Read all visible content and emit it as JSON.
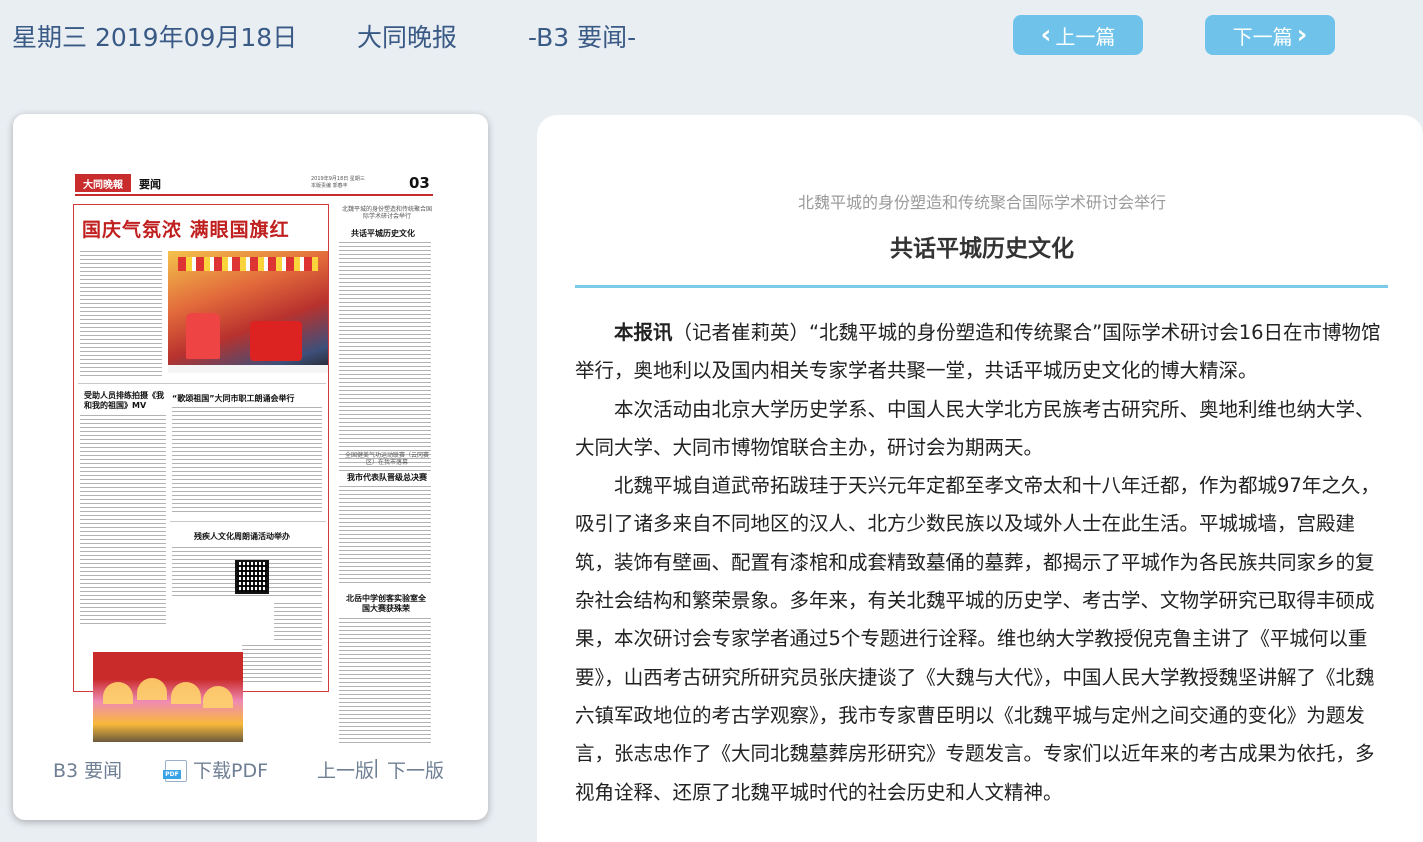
{
  "header": {
    "date": "星期三 2019年09月18日",
    "paper_name": "大同晚报",
    "section": "-B3 要闻-",
    "prev_label": "上一篇",
    "next_label": "下一篇"
  },
  "page_thumbnail": {
    "logo": "大同晚報",
    "section": "要闻",
    "date_line": "2019年9月18日 星期三",
    "editor_line": "本版责编 郭春丰",
    "page_number": "03",
    "headline": "国庆气氛浓 满眼国旗红",
    "stories": [
      "受助人员排练拍摄《我和我的祖国》MV",
      "“歌颂祖国”大同市职工朗诵会举行",
      "残疾人文化周朗诵活动举办",
      "北魏平城的身份塑造和传统聚合国际学术研讨会举行",
      "共话平城历史文化",
      "全国健美气功运动联赛（云冈赛区）在我市落幕",
      "我市代表队晋级总决赛",
      "北岳中学创客实验室全国大赛获殊荣"
    ]
  },
  "card_footer": {
    "section": "B3 要闻",
    "download_pdf": "下载PDF",
    "prev_edition": "上一版",
    "separator": "|",
    "next_edition": "下一版"
  },
  "article": {
    "subtitle": "北魏平城的身份塑造和传统聚合国际学术研讨会举行",
    "title": "共话平城历史文化",
    "lead": "本报讯",
    "paragraphs": [
      "（记者崔莉英）“北魏平城的身份塑造和传统聚合”国际学术研讨会16日在市博物馆举行，奥地利以及国内相关专家学者共聚一堂，共话平城历史文化的博大精深。",
      "本次活动由北京大学历史学系、中国人民大学北方民族考古研究所、奥地利维也纳大学、大同大学、大同市博物馆联合主办，研讨会为期两天。",
      "北魏平城自道武帝拓跋珪于天兴元年定都至孝文帝太和十八年迁都，作为都城97年之久，吸引了诸多来自不同地区的汉人、北方少数民族以及域外人士在此生活。平城城墙，宫殿建筑，装饰有壁画、配置有漆棺和成套精致墓俑的墓葬，都揭示了平城作为各民族共同家乡的复杂社会结构和繁荣景象。多年来，有关北魏平城的历史学、考古学、文物学研究已取得丰硕成果，本次研讨会专家学者通过5个专题进行诠释。维也纳大学教授倪克鲁主讲了《平城何以重要》，山西考古研究所研究员张庆捷谈了《大魏与大代》，中国人民大学教授魏坚讲解了《北魏六镇军政地位的考古学观察》，我市专家曹臣明以《北魏平城与定州之间交通的变化》为题发言，张志忠作了《大同北魏墓葬房形研究》专题发言。专家们以近年来的考古成果为依托，多视角诠释、还原了北魏平城时代的社会历史和人文精神。"
    ]
  }
}
